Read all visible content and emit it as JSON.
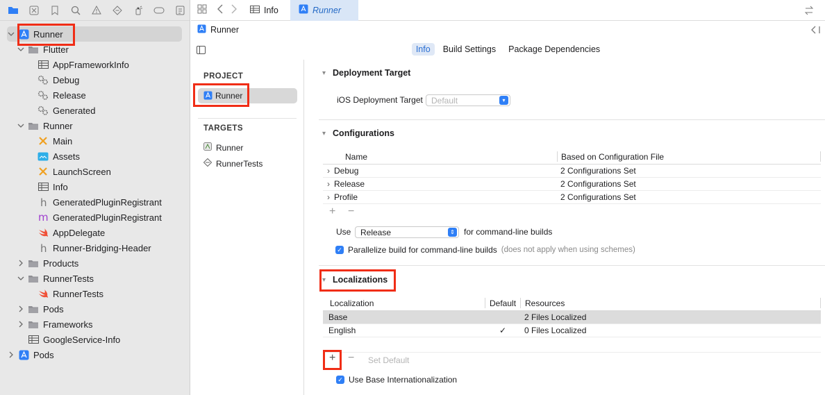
{
  "navigator": {
    "toolbar_icons": [
      "folder-icon",
      "x-square-icon",
      "bookmark-icon",
      "search-icon",
      "warning-icon",
      "diamond-icon",
      "spray-icon",
      "tag-icon",
      "list-icon"
    ],
    "items": [
      {
        "label": "Runner",
        "icon": "xcode-project-icon",
        "depth": 0,
        "disclosure": "down",
        "selected": true
      },
      {
        "label": "Flutter",
        "icon": "folder-icon",
        "depth": 1,
        "disclosure": "down"
      },
      {
        "label": "AppFrameworkInfo",
        "icon": "plist-icon",
        "depth": 2
      },
      {
        "label": "Debug",
        "icon": "gears-icon",
        "depth": 2
      },
      {
        "label": "Release",
        "icon": "gears-icon",
        "depth": 2
      },
      {
        "label": "Generated",
        "icon": "gears-icon",
        "depth": 2
      },
      {
        "label": "Runner",
        "icon": "folder-icon",
        "depth": 1,
        "disclosure": "down"
      },
      {
        "label": "Main",
        "icon": "storyboard-icon",
        "depth": 2
      },
      {
        "label": "Assets",
        "icon": "asset-catalog-icon",
        "depth": 2
      },
      {
        "label": "LaunchScreen",
        "icon": "storyboard-icon",
        "depth": 2
      },
      {
        "label": "Info",
        "icon": "plist-icon",
        "depth": 2
      },
      {
        "label": "GeneratedPluginRegistrant",
        "icon": "header-h-icon",
        "depth": 2
      },
      {
        "label": "GeneratedPluginRegistrant",
        "icon": "objc-m-icon",
        "depth": 2
      },
      {
        "label": "AppDelegate",
        "icon": "swift-icon",
        "depth": 2
      },
      {
        "label": "Runner-Bridging-Header",
        "icon": "header-h-icon",
        "depth": 2
      },
      {
        "label": "Products",
        "icon": "folder-icon",
        "depth": 1,
        "disclosure": "right"
      },
      {
        "label": "RunnerTests",
        "icon": "folder-icon",
        "depth": 1,
        "disclosure": "down"
      },
      {
        "label": "RunnerTests",
        "icon": "swift-icon",
        "depth": 2
      },
      {
        "label": "Pods",
        "icon": "folder-icon",
        "depth": 1,
        "disclosure": "right"
      },
      {
        "label": "Frameworks",
        "icon": "folder-icon",
        "depth": 1,
        "disclosure": "right"
      },
      {
        "label": "GoogleService-Info",
        "icon": "plist-icon",
        "depth": 1
      },
      {
        "label": "Pods",
        "icon": "xcode-project-icon",
        "depth": 0,
        "disclosure": "right"
      }
    ]
  },
  "tabs": {
    "items": [
      {
        "label": "Info",
        "icon": "plist-icon"
      },
      {
        "label": "Runner",
        "icon": "xcode-project-icon",
        "active": true
      }
    ]
  },
  "jumpbar": {
    "label": "Runner"
  },
  "segments": [
    "Info",
    "Build Settings",
    "Package Dependencies"
  ],
  "sidebar": {
    "project_header": "PROJECT",
    "project_item": "Runner",
    "targets_header": "TARGETS",
    "targets": [
      {
        "label": "Runner"
      },
      {
        "label": "RunnerTests"
      }
    ]
  },
  "deployment": {
    "title": "Deployment Target",
    "label": "iOS Deployment Target",
    "value": "Default"
  },
  "configurations": {
    "title": "Configurations",
    "columns": [
      "Name",
      "Based on Configuration File"
    ],
    "rows": [
      {
        "name": "Debug",
        "file": "2 Configurations Set"
      },
      {
        "name": "Release",
        "file": "2 Configurations Set"
      },
      {
        "name": "Profile",
        "file": "2 Configurations Set"
      }
    ],
    "use_label": "Use",
    "use_value": "Release",
    "use_suffix": "for command-line builds",
    "parallelize_label": "Parallelize build for command-line builds",
    "parallelize_note": "(does not apply when using schemes)"
  },
  "localizations": {
    "title": "Localizations",
    "columns": [
      "Localization",
      "Default",
      "Resources"
    ],
    "rows": [
      {
        "name": "Base",
        "default": "",
        "resources": "2 Files Localized"
      },
      {
        "name": "English",
        "default": "✓",
        "resources": "0 Files Localized"
      }
    ],
    "set_default": "Set Default",
    "base_intl": "Use Base Internationalization"
  },
  "colors": {
    "accent": "#2f7ff6",
    "highlight": "#f02d16"
  }
}
